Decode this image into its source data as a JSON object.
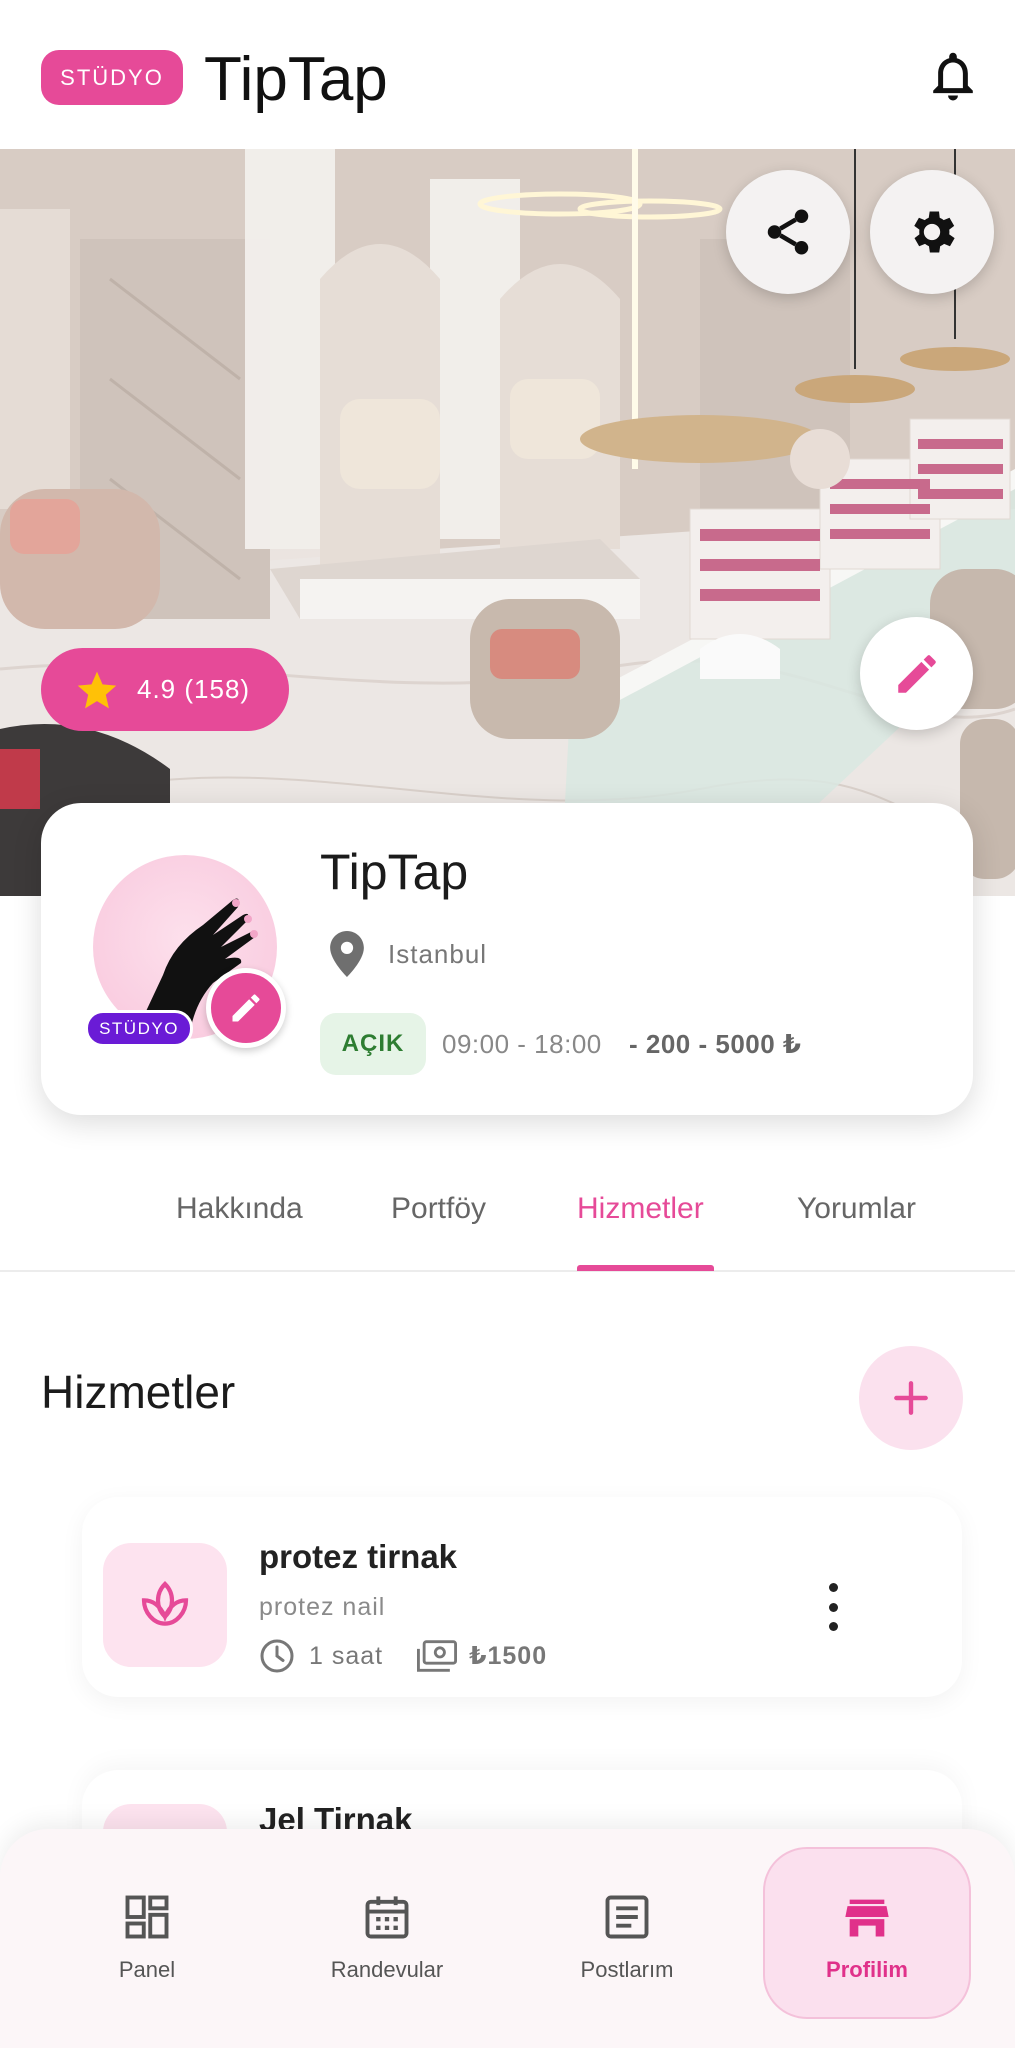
{
  "header": {
    "badge": "STÜDYO",
    "title": "TipTap"
  },
  "hero": {
    "rating": "4.9 (158)"
  },
  "profile": {
    "name": "TipTap",
    "badge": "STÜDYO",
    "location": "Istanbul",
    "status": "AÇIK",
    "hours": "09:00 - 18:00",
    "price_range": "- 200 - 5000 ₺"
  },
  "tabs": [
    {
      "label": "Hakkında"
    },
    {
      "label": "Portföy"
    },
    {
      "label": "Hizmetler"
    },
    {
      "label": "Yorumlar"
    }
  ],
  "active_tab": "Hizmetler",
  "services_section": {
    "title": "Hizmetler"
  },
  "services": [
    {
      "name": "protez tirnak",
      "description": "protez nail",
      "duration": "1 saat",
      "price": "₺1500"
    },
    {
      "name": "Jel Tirnak"
    }
  ],
  "bottom_nav": [
    {
      "label": "Panel",
      "icon": "dashboard-icon"
    },
    {
      "label": "Randevular",
      "icon": "calendar-icon"
    },
    {
      "label": "Postlarım",
      "icon": "article-icon"
    },
    {
      "label": "Profilim",
      "icon": "store-icon"
    }
  ],
  "colors": {
    "accent": "#e64a98",
    "accent_light": "#fbe1ee",
    "studio_purple": "#6a1bd6",
    "open_green": "#2e7d32",
    "rating_star": "#ffc107"
  }
}
